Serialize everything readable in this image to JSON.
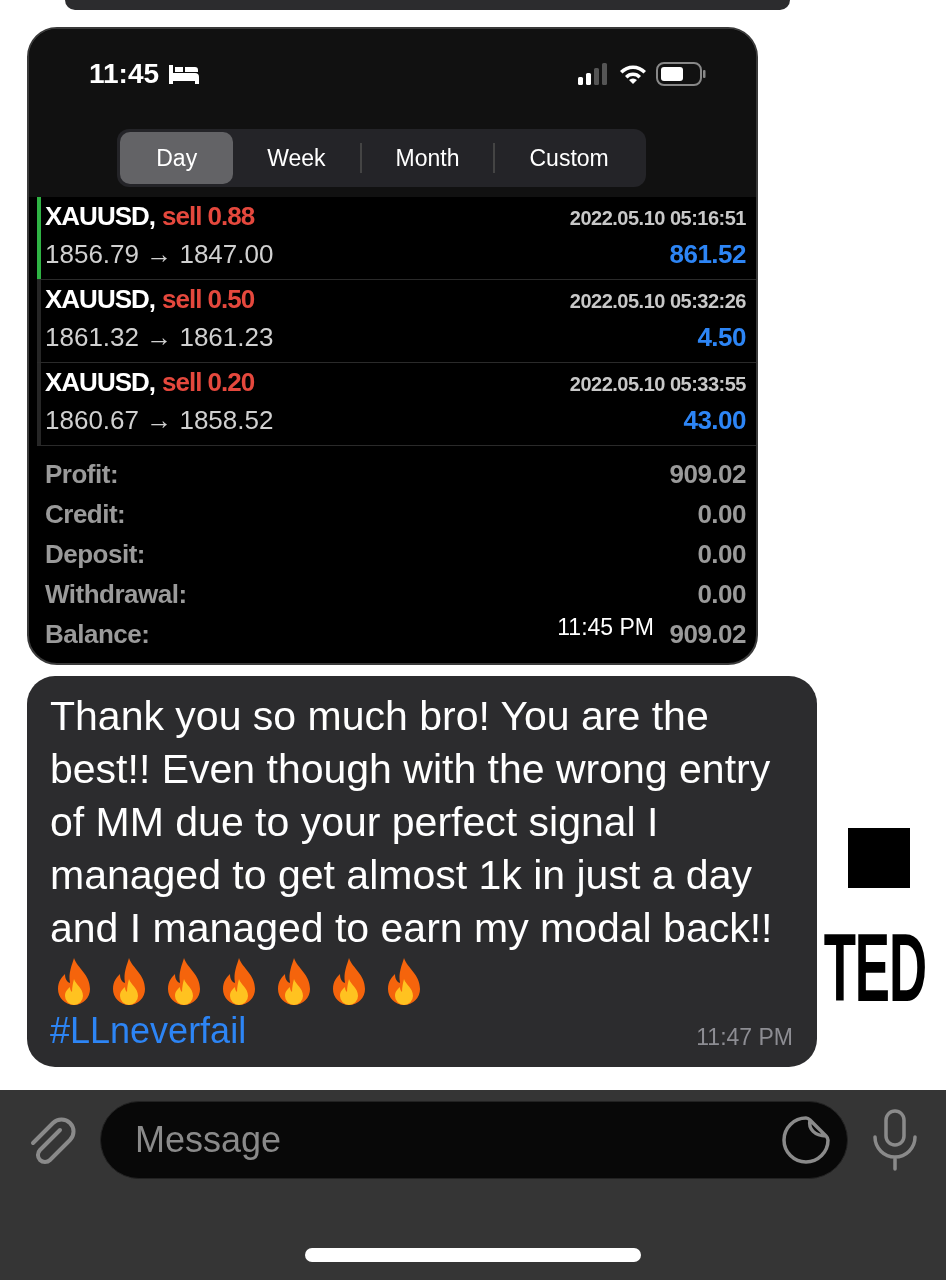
{
  "background_text": "TED",
  "photo_message": {
    "status_bar": {
      "time": "11:45"
    },
    "tabs": [
      {
        "label": "Day",
        "selected": true
      },
      {
        "label": "Week",
        "selected": false
      },
      {
        "label": "Month",
        "selected": false
      },
      {
        "label": "Custom",
        "selected": false
      }
    ],
    "trades": [
      {
        "symbol": "XAUUSD,",
        "side": "sell 0.88",
        "prices": "1856.79 → 1847.00",
        "time": "2022.05.10 05:16:51",
        "profit": "861.52",
        "selected": true
      },
      {
        "symbol": "XAUUSD,",
        "side": "sell 0.50",
        "prices": "1861.32 → 1861.23",
        "time": "2022.05.10 05:32:26",
        "profit": "4.50",
        "selected": false
      },
      {
        "symbol": "XAUUSD,",
        "side": "sell 0.20",
        "prices": "1860.67 → 1858.52",
        "time": "2022.05.10 05:33:55",
        "profit": "43.00",
        "selected": false
      }
    ],
    "summary": [
      {
        "label": "Profit:",
        "value": "909.02"
      },
      {
        "label": "Credit:",
        "value": "0.00"
      },
      {
        "label": "Deposit:",
        "value": "0.00"
      },
      {
        "label": "Withdrawal:",
        "value": "0.00"
      },
      {
        "label": "Balance:",
        "value": "909.02"
      }
    ],
    "timestamp": "11:45 PM"
  },
  "text_message": {
    "text": "Thank you so much bro! You are the best!! Even though with the wrong entry of MM due to your perfect signal I managed to get almost 1k in just a day and I managed to earn my modal back!!",
    "flames": [
      {
        "kind": "fire"
      },
      {
        "kind": "fire"
      },
      {
        "kind": "fire"
      },
      {
        "kind": "fire"
      },
      {
        "kind": "fire"
      },
      {
        "kind": "fire"
      },
      {
        "kind": "fire"
      }
    ],
    "hashtag": "#LLneverfail",
    "time": "11:47 PM"
  },
  "composer": {
    "placeholder": "Message"
  }
}
